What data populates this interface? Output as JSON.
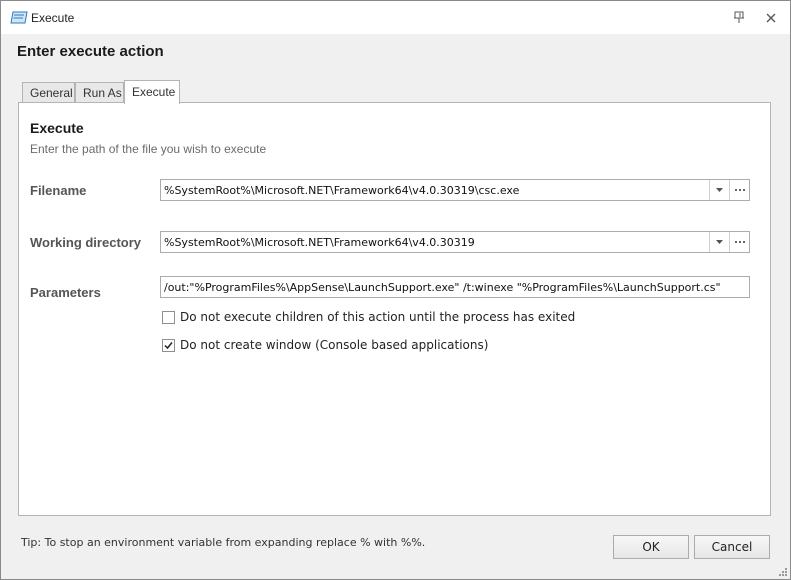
{
  "window": {
    "title": "Execute",
    "icon": "execute-app-icon",
    "controls": {
      "pin": "pin-icon",
      "close": "close-icon"
    }
  },
  "dialog": {
    "heading": "Enter execute action"
  },
  "tabs": [
    {
      "label": "General",
      "active": false
    },
    {
      "label": "Run As",
      "active": false
    },
    {
      "label": "Execute",
      "active": true
    }
  ],
  "section": {
    "title": "Execute",
    "description": "Enter the path of the file you wish to execute"
  },
  "fields": {
    "filename": {
      "label": "Filename",
      "value": "%SystemRoot%\\Microsoft.NET\\Framework64\\v4.0.30319\\csc.exe"
    },
    "working_directory": {
      "label": "Working directory",
      "value": "%SystemRoot%\\Microsoft.NET\\Framework64\\v4.0.30319"
    },
    "parameters": {
      "label": "Parameters",
      "value": "/out:\"%ProgramFiles%\\AppSense\\LaunchSupport.exe\" /t:winexe \"%ProgramFiles%\\LaunchSupport.cs\""
    }
  },
  "options": [
    {
      "label": "Do not execute children of this action until the process has exited",
      "checked": false
    },
    {
      "label": "Do not create window (Console based applications)",
      "checked": true
    }
  ],
  "footer": {
    "tip": "Tip: To stop an environment variable from expanding replace % with %%.",
    "ok_label": "OK",
    "cancel_label": "Cancel"
  }
}
